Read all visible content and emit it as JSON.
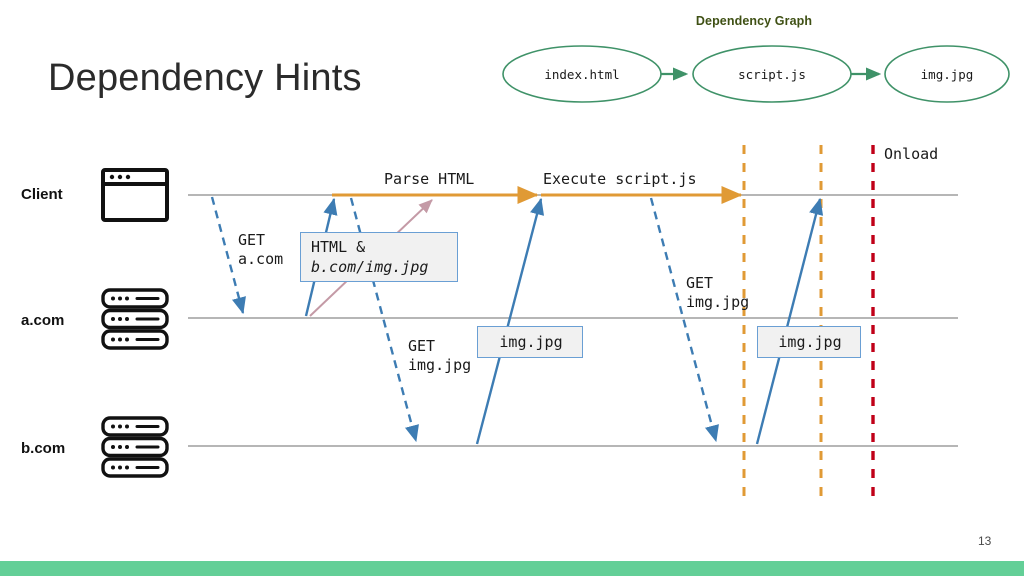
{
  "slide": {
    "title": "Dependency Hints",
    "page_number": "13",
    "footer_color": "#63cf97",
    "background_color": "#ffffff"
  },
  "dependency_graph": {
    "title": "Dependency Graph",
    "title_color": "#3f5014",
    "node_color": "#3f9268",
    "nodes": [
      {
        "label": "index.html"
      },
      {
        "label": "script.js"
      },
      {
        "label": "img.jpg"
      }
    ],
    "edges": [
      {
        "from": "index.html",
        "to": "script.js"
      },
      {
        "from": "script.js",
        "to": "img.jpg"
      }
    ]
  },
  "sequence_diagram": {
    "lanes": [
      {
        "name": "Client",
        "icon": "browser-window-icon"
      },
      {
        "name": "a.com",
        "icon": "server-stack-icon"
      },
      {
        "name": "b.com",
        "icon": "server-stack-icon"
      }
    ],
    "activity_labels": [
      {
        "id": "parse-html",
        "text": "Parse HTML",
        "color": "#e09a35"
      },
      {
        "id": "execute-script",
        "text": "Execute script.js",
        "color": "#e09a35"
      },
      {
        "id": "onload",
        "text": "Onload",
        "color": "#c00018"
      }
    ],
    "request_labels": [
      {
        "id": "get-acom",
        "text": "GET\na.com"
      },
      {
        "id": "get-imgjpg-1",
        "text": "GET\nimg.jpg"
      },
      {
        "id": "get-imgjpg-2",
        "text": "GET\nimg.jpg"
      }
    ],
    "message_boxes": [
      {
        "id": "html-bcom",
        "line1": "HTML &",
        "line2": "b.com/img.jpg"
      },
      {
        "id": "imgjpg-1",
        "line1": "img.jpg"
      },
      {
        "id": "imgjpg-2",
        "line1": "img.jpg"
      }
    ],
    "markers": [
      {
        "id": "marker-1",
        "color": "#e09a35",
        "style": "dashed"
      },
      {
        "id": "marker-2",
        "color": "#e09a35",
        "style": "dashed"
      },
      {
        "id": "marker-onload",
        "color": "#c00018",
        "style": "dashed"
      }
    ],
    "colors": {
      "lane_line": "#9e9e9e",
      "request_arrow": "#3d7cb3",
      "response_arrow": "#3d7cb3",
      "hint_arrow": "#c49aa6",
      "activity_arrow": "#e09a35",
      "box_border": "#6a9fd4",
      "box_fill": "#f1f1f1"
    }
  }
}
